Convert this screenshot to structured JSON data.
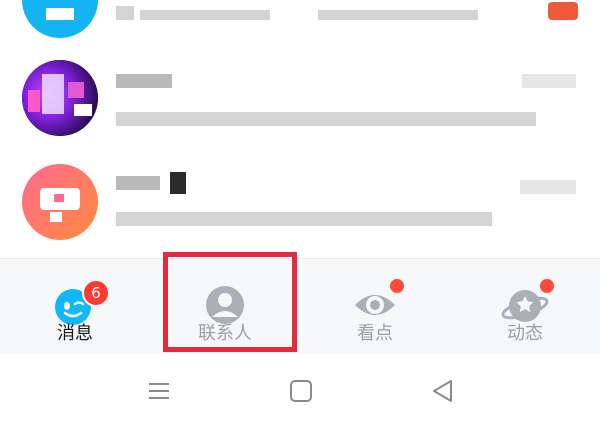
{
  "tabs": [
    {
      "label": "消息",
      "icon": "qq-penguin-icon",
      "badge": "6",
      "active": true
    },
    {
      "label": "联系人",
      "icon": "contacts-icon",
      "badge": null,
      "active": false
    },
    {
      "label": "看点",
      "icon": "eye-icon",
      "badge": "dot",
      "active": false
    },
    {
      "label": "动态",
      "icon": "planet-star-icon",
      "badge": "dot",
      "active": false
    }
  ],
  "colors": {
    "accent_blue": "#12b7f5",
    "badge_red": "#ff3b30",
    "highlight_red": "#e52b3e",
    "inactive_gray": "#9aa0a6"
  },
  "system_nav": [
    "menu-icon",
    "home-icon",
    "back-icon"
  ]
}
